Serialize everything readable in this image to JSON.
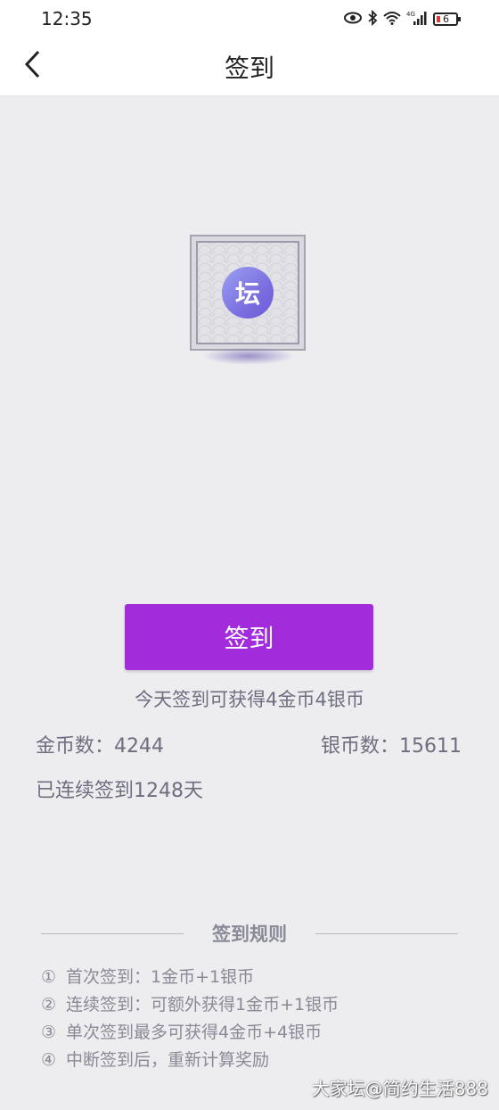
{
  "status_bar": {
    "time": "12:35",
    "icons": [
      "eye-icon",
      "bluetooth-icon",
      "wifi-icon",
      "signal-4g-icon"
    ],
    "network_label": "4G",
    "battery": "6"
  },
  "nav": {
    "title": "签到",
    "back_icon": "chevron-left-icon"
  },
  "badge": {
    "char": "坛"
  },
  "checkin": {
    "button_label": "签到",
    "reward_tip": "今天签到可获得4金币4银币",
    "gold_label": "金币数：4244",
    "silver_label": "银币数：15611",
    "streak_label": "已连续签到1248天"
  },
  "rules": {
    "title": "签到规则",
    "items": [
      {
        "num": "①",
        "text": "首次签到：1金币+1银币"
      },
      {
        "num": "②",
        "text": "连续签到：可额外获得1金币+1银币"
      },
      {
        "num": "③",
        "text": "单次签到最多可获得4金币+4银币"
      },
      {
        "num": "④",
        "text": "中断签到后，重新计算奖励"
      }
    ]
  },
  "watermark": "大家坛@简约生活888",
  "colors": {
    "accent": "#a22bdc",
    "background": "#ededf0"
  }
}
